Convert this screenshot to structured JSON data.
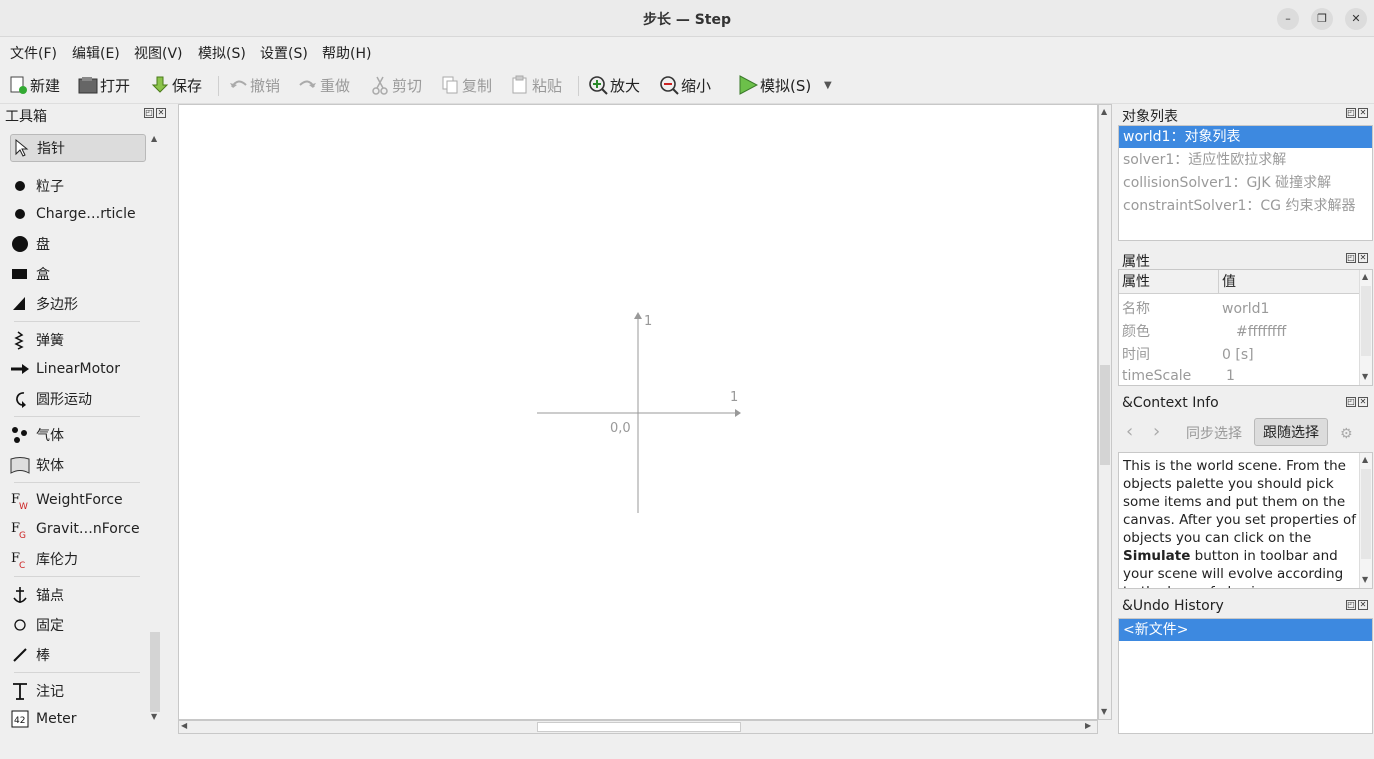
{
  "window": {
    "title": "步长 — Step"
  },
  "menu": [
    "文件(F)",
    "编辑(E)",
    "视图(V)",
    "模拟(S)",
    "设置(S)",
    "帮助(H)"
  ],
  "toolbar": {
    "new": "新建",
    "open": "打开",
    "save": "保存",
    "undo": "撤销",
    "redo": "重做",
    "cut": "剪切",
    "copy": "复制",
    "paste": "粘贴",
    "zoom_in": "放大",
    "zoom_out": "缩小",
    "simulate": "模拟(S)"
  },
  "toolbox": {
    "title": "工具箱",
    "items": [
      "指针",
      "粒子",
      "Charge…rticle",
      "盘",
      "盒",
      "多边形",
      "弹簧",
      "LinearMotor",
      "圆形运动",
      "气体",
      "软体",
      "WeightForce",
      "Gravit…nForce",
      "库伦力",
      "锚点",
      "固定",
      "棒",
      "注记",
      "Meter"
    ]
  },
  "canvas": {
    "origin_label": "0,0",
    "x_label": "1",
    "y_label": "1"
  },
  "object_list": {
    "title": "对象列表",
    "items": [
      "world1：对象列表",
      "solver1：适应性欧拉求解",
      "collisionSolver1：GJK 碰撞求解",
      "constraintSolver1：CG 约束求解器"
    ]
  },
  "properties": {
    "title": "属性",
    "col_prop": "属性",
    "col_value": "值",
    "rows": [
      {
        "name": "名称",
        "value": "world1"
      },
      {
        "name": "颜色",
        "value": "#ffffffff"
      },
      {
        "name": "时间",
        "value": "0 [s]"
      },
      {
        "name": "timeScale",
        "value": "1"
      }
    ]
  },
  "context": {
    "title": "&Context Info",
    "sync": "同步选择",
    "follow": "跟随选择",
    "text_1": "This is the world scene. From the objects palette you should pick some items and put them on the canvas. After you set properties of objects you can click on the ",
    "text_bold": "Simulate",
    "text_2": " button in toolbar and your scene will evolve according to the laws of physics."
  },
  "undo_history": {
    "title": "&Undo History",
    "items": [
      "<新文件>"
    ]
  }
}
